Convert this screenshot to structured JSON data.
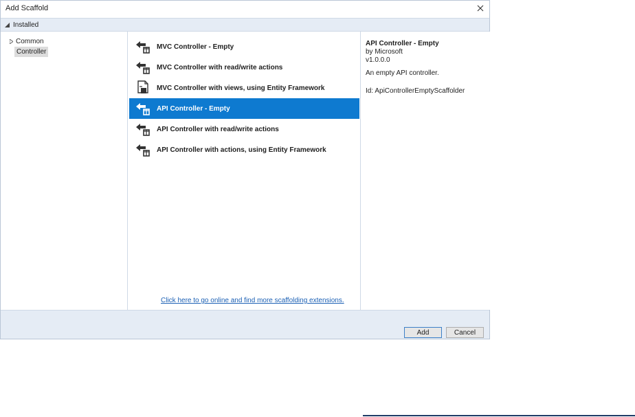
{
  "window": {
    "title": "Add Scaffold",
    "close_icon": "close-icon"
  },
  "header": {
    "installed_label": "Installed"
  },
  "tree": {
    "items": [
      {
        "label": "Common",
        "expanded": false
      },
      {
        "label": "Controller",
        "selected": true
      }
    ]
  },
  "scaffolds": {
    "items": [
      {
        "label": "MVC Controller - Empty",
        "icon": "controller-icon"
      },
      {
        "label": "MVC Controller with read/write actions",
        "icon": "controller-icon"
      },
      {
        "label": "MVC Controller with views, using Entity Framework",
        "icon": "controller-views-icon"
      },
      {
        "label": "API Controller - Empty",
        "icon": "controller-icon",
        "selected": true
      },
      {
        "label": "API Controller with read/write actions",
        "icon": "controller-icon"
      },
      {
        "label": "API Controller with actions, using Entity Framework",
        "icon": "controller-icon"
      }
    ],
    "online_link": "Click here to go online and find more scaffolding extensions."
  },
  "details": {
    "title": "API Controller - Empty",
    "author": "by Microsoft",
    "version": "v1.0.0.0",
    "description": "An empty API controller.",
    "id": "Id: ApiControllerEmptyScaffolder"
  },
  "buttons": {
    "add": "Add",
    "cancel": "Cancel"
  },
  "colors": {
    "selection": "#0e7ad0",
    "panel_bg": "#e5ecf5",
    "link": "#1a5fb4"
  }
}
